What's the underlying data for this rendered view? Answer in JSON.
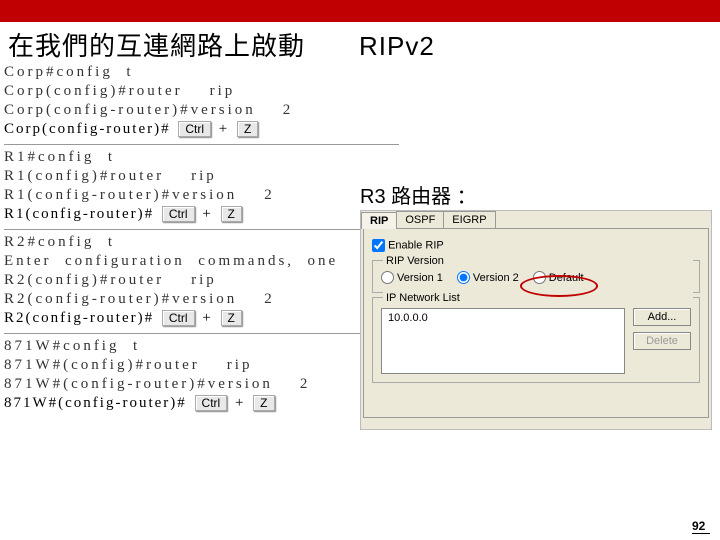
{
  "title": "在我們的互連網路上啟動　　RIPv2",
  "cli": {
    "groups": [
      {
        "lines": [
          "Corp#config  t",
          "Corp(config)#router    rip",
          "Corp(config-router)#version    2"
        ],
        "prompt": "Corp(config-router)#"
      },
      {
        "lines": [
          "R1#config  t",
          "R1(config)#router    rip",
          "R1(config-router)#version    2"
        ],
        "prompt": "R1(config-router)#"
      },
      {
        "lines": [
          "R2#config  t",
          "Enter  configuration  commands,  one",
          "R2(config)#router    rip",
          "R2(config-router)#version    2"
        ],
        "prompt": "R2(config-router)#"
      },
      {
        "lines": [
          "871W#config  t",
          "871W#(config)#router    rip",
          "871W#(config-router)#version    2"
        ],
        "prompt": "871W#(config-router)#"
      }
    ],
    "keys": {
      "ctrl": "Ctrl",
      "plus": "+",
      "z": "Z"
    }
  },
  "r3_label": "R3 路由器 ：",
  "gui": {
    "tabs": {
      "rip": "RIP",
      "ospf": "OSPF",
      "eigrp": "EIGRP"
    },
    "enable_label": "Enable RIP",
    "version_legend": "RIP Version",
    "versions": {
      "v1": "Version 1",
      "v2": "Version 2",
      "def": "Default"
    },
    "netlist_legend": "IP Network List",
    "netlist_entry": "10.0.0.0",
    "buttons": {
      "add": "Add...",
      "delete": "Delete"
    }
  },
  "pagenum": "92"
}
